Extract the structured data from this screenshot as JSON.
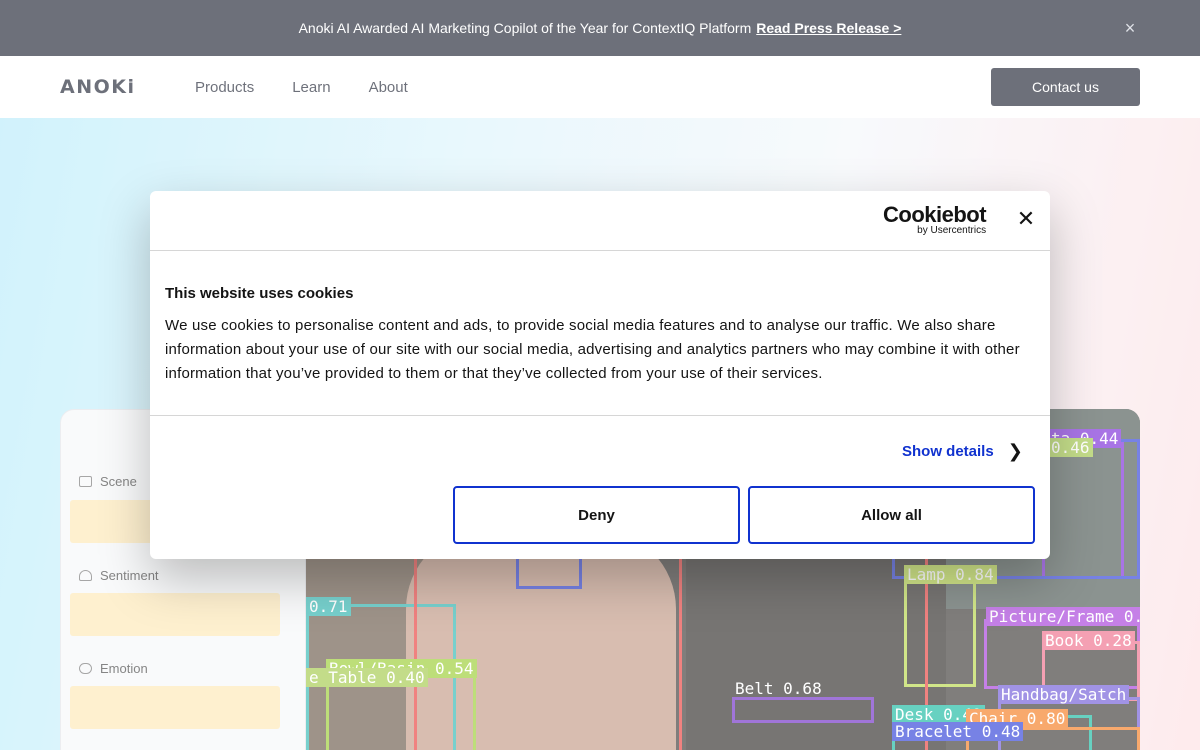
{
  "announcement": {
    "text": "Anoki AI Awarded AI Marketing Copilot of the Year for ContextIQ Platform",
    "link": "Read Press Release >",
    "close": "×"
  },
  "nav": {
    "logo": "ANOKi",
    "items": [
      "Products",
      "Learn",
      "About"
    ],
    "contact": "Contact us"
  },
  "sidebar": {
    "labels": [
      "Scene",
      "Sentiment",
      "Emotion"
    ]
  },
  "detections": [
    {
      "label": "Lamp 0.84",
      "color": "#b8d94a"
    },
    {
      "label": "Picture/Frame 0.",
      "color": "#a63ddb"
    },
    {
      "label": "Book 0.28",
      "color": "#ef6e8a"
    },
    {
      "label": "Handbag/Satch",
      "color": "#6f5ad8"
    },
    {
      "label": "Belt 0.68",
      "color": "#6d2cc4"
    },
    {
      "label": "Bowl/Basin 0.54",
      "color": "#9acd32"
    },
    {
      "label": "Desk 0.49",
      "color": "#16b8a0"
    },
    {
      "label": "Chair 0.80",
      "color": "#f57c1f"
    },
    {
      "label": "Bracelet 0.48",
      "color": "#2f3fd8"
    },
    {
      "label": "ta 0.44",
      "color": "#7a2ad8"
    },
    {
      "label": "0.46",
      "color": "#a4c94a"
    },
    {
      "label": "0.71",
      "color": "#2fb7b2"
    },
    {
      "label": "e Table 0.40",
      "color": "#a4c94a"
    }
  ],
  "cookie": {
    "brand": "Cookiebot",
    "brand_sub": "by Usercentrics",
    "title": "This website uses cookies",
    "body": "We use cookies to personalise content and ads, to provide social media features and to analyse our traffic. We also share information about your use of our site with our social media, advertising and analytics partners who may combine it with other information that you’ve provided to them or that they’ve collected from your use of their services.",
    "show_details": "Show details",
    "deny": "Deny",
    "allow": "Allow all",
    "accent": "#1032cf"
  }
}
